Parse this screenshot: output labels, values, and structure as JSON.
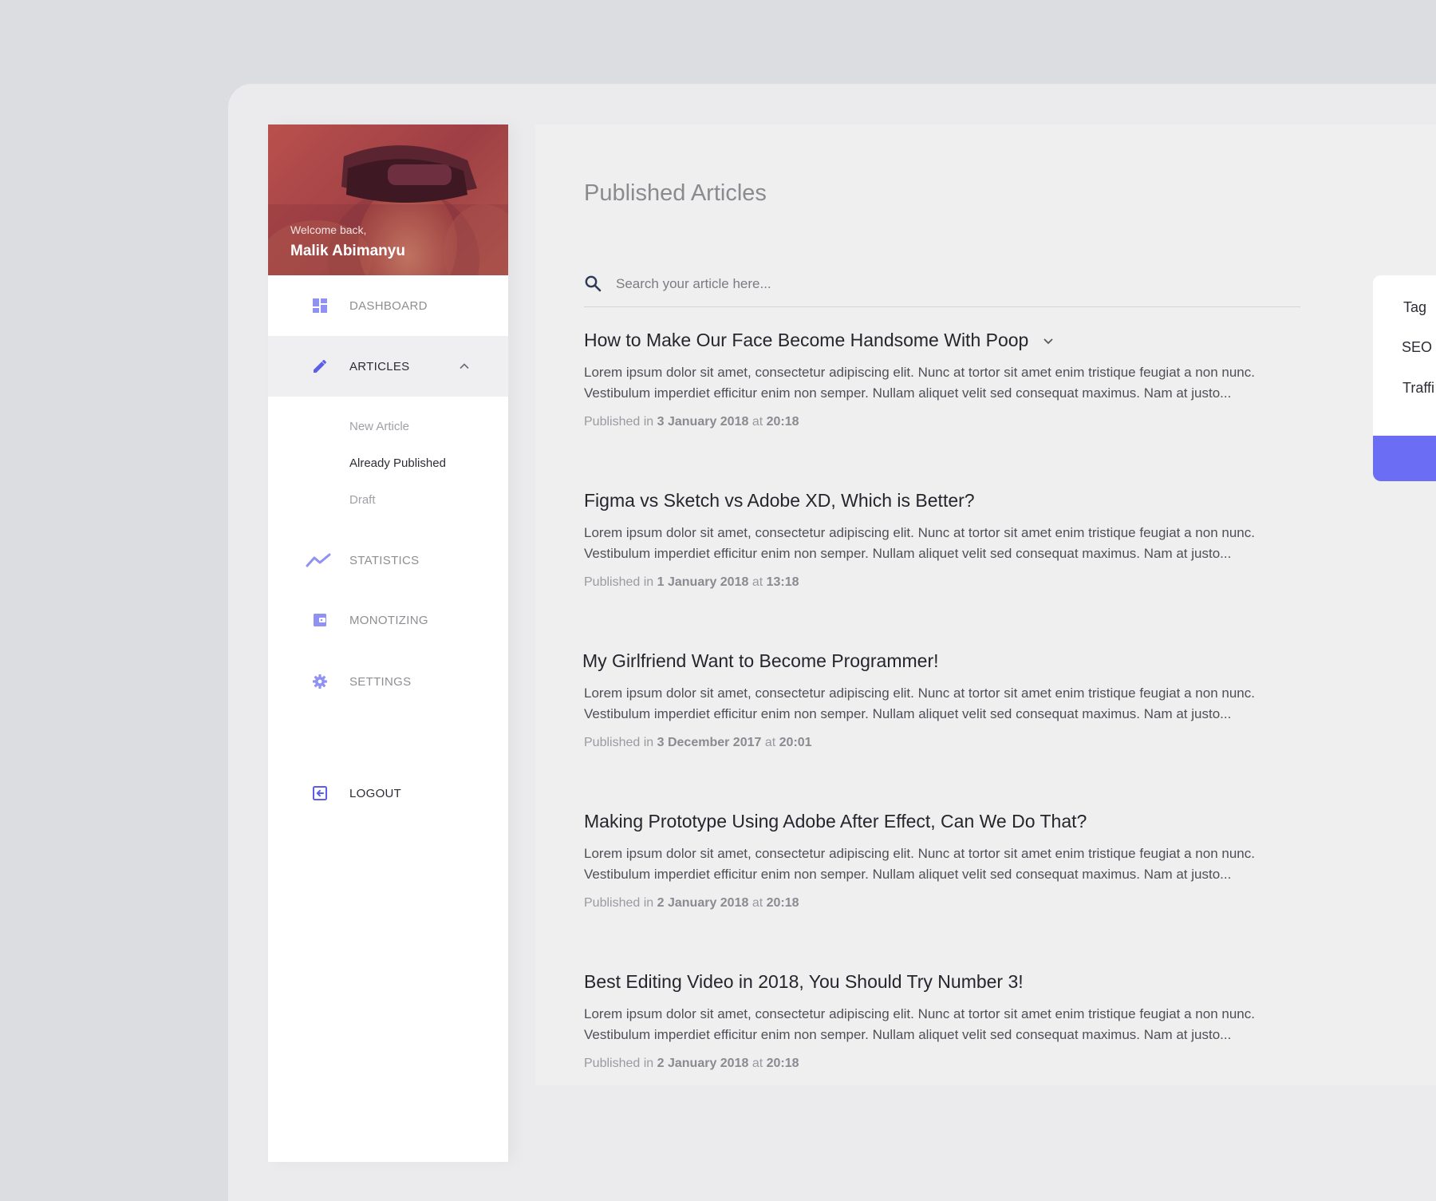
{
  "sidebar": {
    "welcome": "Welcome back,",
    "user_name": "Malik Abimanyu",
    "nav": {
      "dashboard": "DASHBOARD",
      "articles": "ARTICLES",
      "statistics": "STATISTICS",
      "monotizing": "MONOTIZING",
      "settings": "SETTINGS",
      "logout": "LOGOUT"
    },
    "sub_items": {
      "new_article": "New Article",
      "already_published": "Already Published",
      "draft": "Draft"
    }
  },
  "main": {
    "title": "Published Articles",
    "search": {
      "placeholder": "Search your article here..."
    },
    "published_prefix": "Published in",
    "articles": [
      {
        "title": "How to Make Our Face Become Handsome With Poop",
        "excerpt": "Lorem ipsum dolor sit amet, consectetur adipiscing elit. Nunc at tortor sit amet enim tristique feugiat a non nunc. Vestibulum imperdiet efficitur enim non semper. Nullam aliquet velit sed consequat maximus. Nam at justo...",
        "date": "3 January 2018",
        "at": "at",
        "time": "20:18"
      },
      {
        "title": "Figma vs Sketch vs Adobe XD, Which is Better?",
        "excerpt": "Lorem ipsum dolor sit amet, consectetur adipiscing elit. Nunc at tortor sit amet enim tristique feugiat a non nunc. Vestibulum imperdiet efficitur enim non semper. Nullam aliquet velit sed consequat maximus. Nam at justo...",
        "date": "1 January 2018",
        "at": "at",
        "time": "13:18"
      },
      {
        "title": "My Girlfriend Want to Become Programmer!",
        "excerpt": "Lorem ipsum dolor sit amet, consectetur adipiscing elit. Nunc at tortor sit amet enim tristique feugiat a non nunc. Vestibulum imperdiet efficitur enim non semper. Nullam aliquet velit sed consequat maximus. Nam at justo...",
        "date": "3 December 2017",
        "at": "at",
        "time": "20:01"
      },
      {
        "title": "Making Prototype Using Adobe After Effect, Can We Do That?",
        "excerpt": "Lorem ipsum dolor sit amet, consectetur adipiscing elit. Nunc at tortor sit amet enim tristique feugiat a non nunc. Vestibulum imperdiet efficitur enim non semper. Nullam aliquet velit sed consequat maximus. Nam at justo...",
        "date": "2 January 2018",
        "at": "at",
        "time": "20:18"
      },
      {
        "title": "Best Editing Video in 2018, You Should Try Number 3!",
        "excerpt": "Lorem ipsum dolor sit amet, consectetur adipiscing elit. Nunc at tortor sit amet enim tristique feugiat a non nunc. Vestibulum imperdiet efficitur enim non semper. Nullam aliquet velit sed consequat maximus. Nam at justo...",
        "date": "2 January 2018",
        "at": "at",
        "time": "20:18"
      }
    ]
  },
  "side_panel": {
    "tabs": [
      "Tag",
      "SEO",
      "Traffi"
    ]
  },
  "colors": {
    "accent": "#6b6ef5",
    "nav_icon": "#8f92f0",
    "active_icon": "#5b5ee8"
  },
  "icons": {
    "dashboard": "dashboard-icon",
    "articles": "pencil-icon",
    "statistics": "trend-icon",
    "monotizing": "wallet-icon",
    "settings": "gear-icon",
    "logout": "logout-icon"
  }
}
